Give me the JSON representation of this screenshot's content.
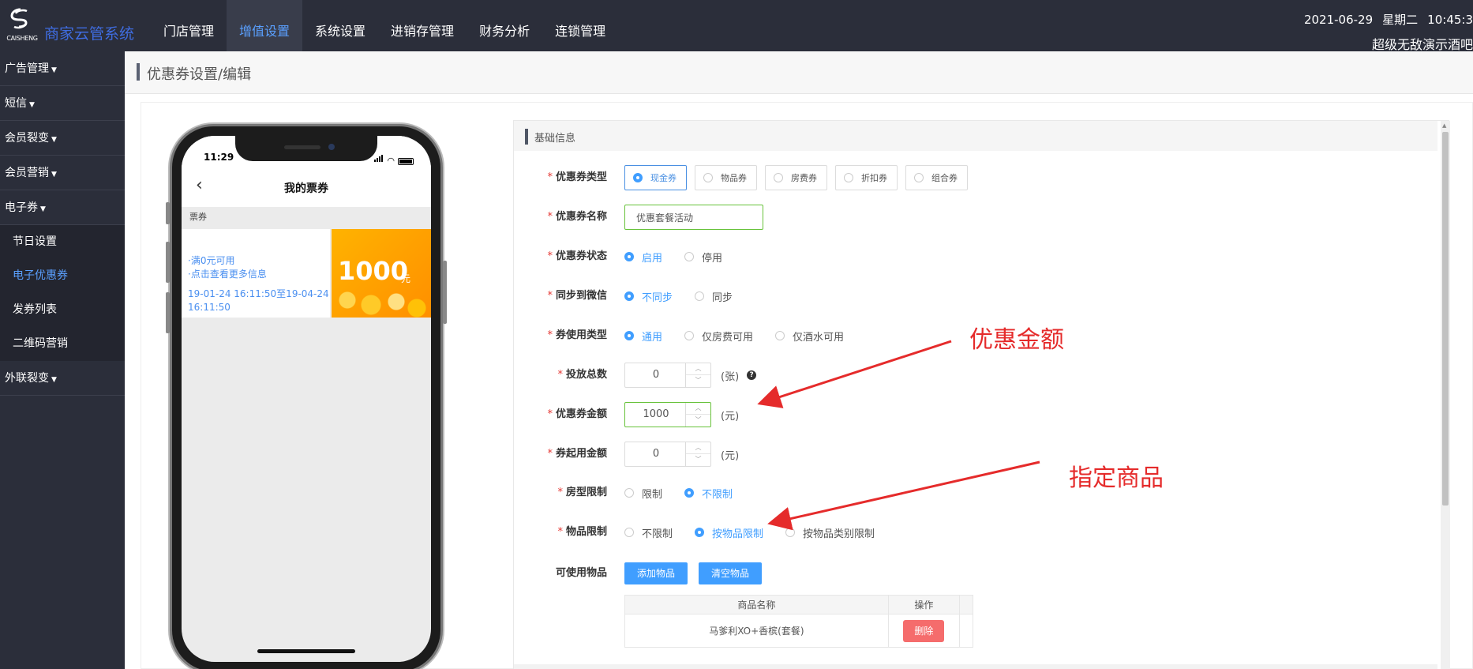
{
  "app": {
    "logo_text": "CAISHENG",
    "title": "商家云管系统"
  },
  "topnav": [
    "门店管理",
    "增值设置",
    "系统设置",
    "进销存管理",
    "财务分析",
    "连锁管理"
  ],
  "topnav_active_index": 1,
  "header_right": {
    "date": "2021-06-29",
    "weekday": "星期二",
    "time": "10:45:3",
    "store": "超级无敌演示酒吧"
  },
  "sidebar": {
    "items": [
      {
        "label": "广告管理"
      },
      {
        "label": "短信"
      },
      {
        "label": "会员裂变"
      },
      {
        "label": "会员营销"
      },
      {
        "label": "电子券"
      },
      {
        "label": "外联裂变"
      }
    ],
    "sub_items": [
      "节日设置",
      "电子优惠券",
      "发券列表",
      "二维码营销"
    ],
    "active_sub_index": 1
  },
  "breadcrumb": "优惠券设置/编辑",
  "phone": {
    "status_time": "11:29",
    "title": "我的票券",
    "section_label": "票券",
    "coupon": {
      "line1": "·满0元可用",
      "line2": "·点击查看更多信息",
      "validity": "19-01-24 16:11:50至19-04-24 16:11:50",
      "amount": "1000",
      "unit": "元"
    }
  },
  "panel": {
    "title": "基础信息"
  },
  "form": {
    "coupon_type": {
      "label": "优惠券类型",
      "options": [
        "现金券",
        "物品券",
        "房费券",
        "折扣券",
        "组合券"
      ],
      "selected": 0
    },
    "coupon_name": {
      "label": "优惠券名称",
      "value": "优惠套餐活动"
    },
    "coupon_status": {
      "label": "优惠券状态",
      "options": [
        "启用",
        "停用"
      ],
      "selected": 0
    },
    "sync_wechat": {
      "label": "同步到微信",
      "options": [
        "不同步",
        "同步"
      ],
      "selected": 0
    },
    "usage_type": {
      "label": "券使用类型",
      "options": [
        "通用",
        "仅房费可用",
        "仅酒水可用"
      ],
      "selected": 0
    },
    "total_issue": {
      "label": "投放总数",
      "value": "0",
      "unit": "(张)",
      "help": "?"
    },
    "coupon_amount": {
      "label": "优惠券金额",
      "value": "1000",
      "unit": "(元)"
    },
    "min_amount": {
      "label": "券起用金额",
      "value": "0",
      "unit": "(元)"
    },
    "room_limit": {
      "label": "房型限制",
      "options": [
        "限制",
        "不限制"
      ],
      "selected": 1
    },
    "goods_limit": {
      "label": "物品限制",
      "options": [
        "不限制",
        "按物品限制",
        "按物品类别限制"
      ],
      "selected": 1
    },
    "usable_goods": {
      "label": "可使用物品",
      "add_button": "添加物品",
      "clear_button": "清空物品",
      "columns": [
        "商品名称",
        "操作"
      ],
      "rows": [
        {
          "name": "马爹利XO+香槟(套餐)",
          "action": "删除"
        }
      ]
    }
  },
  "annotations": [
    {
      "text": "优惠金额",
      "color": "#e52b2b"
    },
    {
      "text": "指定商品",
      "color": "#e52b2b"
    }
  ],
  "colors": {
    "nav_bg": "#2b2e3a",
    "accent": "#409eff",
    "danger": "#f56c6c",
    "success_border": "#67c23a"
  }
}
